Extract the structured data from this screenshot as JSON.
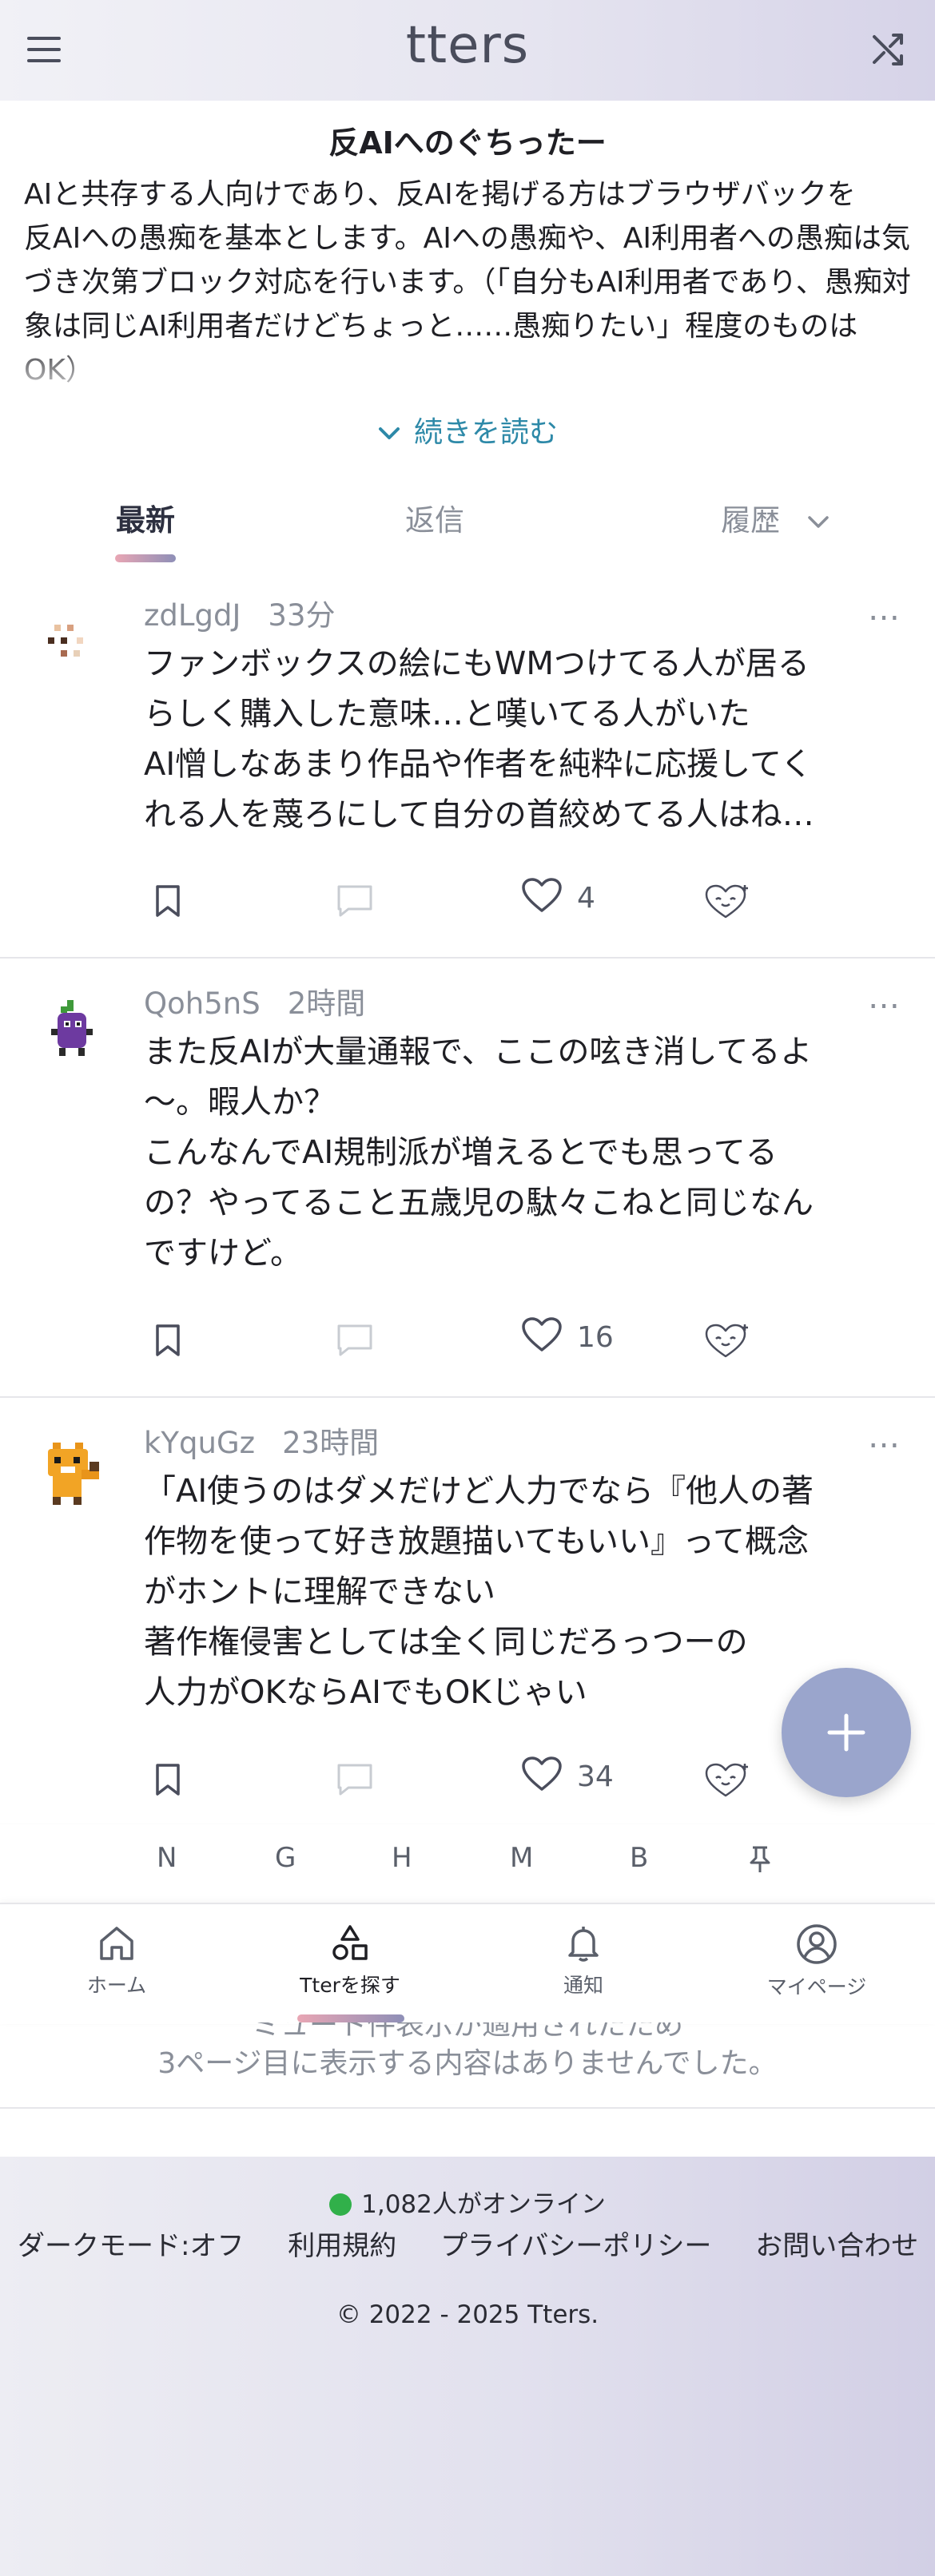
{
  "header": {
    "logo": "tters"
  },
  "board": {
    "title": "反AIへのぐちったー",
    "description": "AIと共存する人向けであり、反AIを掲げる方はブラウザバックを\n反AIへの愚痴を基本とします。AIへの愚痴や、AI利用者への愚痴は気づき次第ブロック対応を行います。（「自分もAI利用者であり、愚痴対象は同じAI利用者だけどちょっと……愚痴りたい」程度のものはOK）",
    "read_more": "続きを読む"
  },
  "tabs": [
    {
      "label": "最新",
      "active": true
    },
    {
      "label": "返信",
      "active": false
    },
    {
      "label": "履歴",
      "active": false
    }
  ],
  "posts": [
    {
      "user": "zdLgdJ",
      "time": "33分",
      "lines": [
        "ファンボックスの絵にもWMつけてる人が居る",
        "らしく購入した意味…と嘆いてる人がいた",
        "AI憎しなあまり作品や作者を純粋に応援してく",
        "れる人を蔑ろにして自分の首絞めてる人はね…"
      ],
      "likes": "4"
    },
    {
      "user": "Qoh5nS",
      "time": "2時間",
      "lines": [
        "また反AIが大量通報で、ここの呟き消してるよ",
        "〜。暇人か？",
        "こんなんでAI規制派が増えるとでも思ってる",
        "の？やってること五歳児の駄々こねと同じなん",
        "ですけど。"
      ],
      "likes": "16"
    },
    {
      "user": "kYquGz",
      "time": "23時間",
      "lines": [
        "「AI使うのはダメだけど人力でなら『他人の著",
        "作物を使って好き放題描いてもいい』って概念",
        "がホントに理解できない",
        "著作権侵害としては全く同じだろっつーの",
        "人力がOKならAIでもOKじゃい"
      ],
      "likes": "34"
    }
  ],
  "more_label": "…",
  "letter_bar": [
    "N",
    "G",
    "H",
    "M",
    "B"
  ],
  "nav": [
    {
      "label": "ホーム",
      "icon": "home-icon"
    },
    {
      "label": "Tterを探す",
      "icon": "shapes-icon",
      "active": true
    },
    {
      "label": "通知",
      "icon": "bell-icon"
    },
    {
      "label": "マイページ",
      "icon": "user-circle-icon"
    }
  ],
  "result_note": {
    "line1": "ミュート件表示が適用されたため",
    "line2": "3ページ目に表示する内容はありませんでした。"
  },
  "footer": {
    "online": "1,082人がオンライン",
    "links": [
      "ダークモード:オフ",
      "利用規約",
      "プライバシーポリシー",
      "お問い合わせ"
    ],
    "copyright": "© 2022 - 2025 Tters."
  },
  "colors": {
    "accent": "#2d89a8",
    "fab": "#9aa5cc",
    "online_dot": "#31b04a"
  }
}
